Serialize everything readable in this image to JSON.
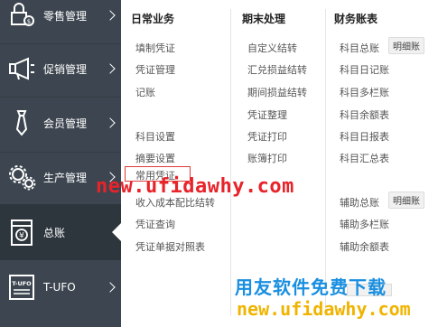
{
  "sidebar": {
    "items": [
      {
        "label": "零售管理",
        "icon": "retail-icon"
      },
      {
        "label": "促销管理",
        "icon": "megaphone-icon"
      },
      {
        "label": "会员管理",
        "icon": "tie-icon"
      },
      {
        "label": "生产管理",
        "icon": "gears-icon"
      },
      {
        "label": "总账",
        "icon": "ledger-icon"
      },
      {
        "label": "T-UFO",
        "icon": "tufo-icon"
      }
    ]
  },
  "panel": {
    "col1": {
      "title": "日常业务",
      "items": [
        "填制凭证",
        "凭证管理",
        "记账",
        "科目设置",
        "摘要设置",
        "常用凭证",
        "收入成本配比结转",
        "凭证查询",
        "凭证单据对照表"
      ]
    },
    "col2": {
      "title": "期末处理",
      "items": [
        "自定义结转",
        "汇兑损益结转",
        "期间损益结转",
        "凭证整理",
        "凭证打印",
        "账簿打印"
      ]
    },
    "col3": {
      "title": "财务账表",
      "items": [
        "科目总账",
        "科目日记账",
        "科目多栏账",
        "科目余额表",
        "科目日报表",
        "科目汇总表",
        "辅助总账",
        "辅助多栏账",
        "辅助余额表"
      ],
      "detail_label": "明细账"
    }
  },
  "watermark": {
    "url_red": "new.ufidawhy.com",
    "slogan": "用友软件免费下载",
    "url_yellow": "new.ufidawhy.com"
  }
}
